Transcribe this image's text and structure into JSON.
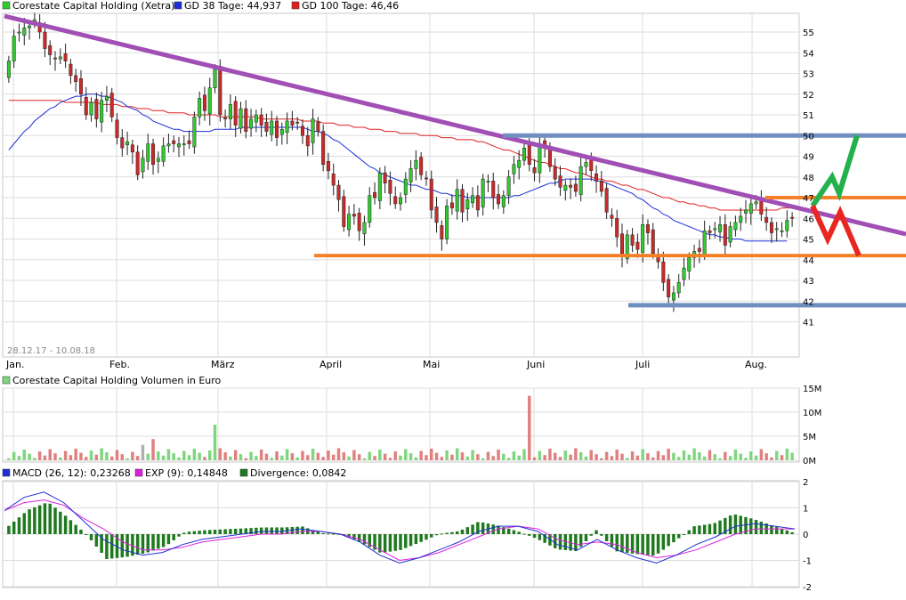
{
  "colors": {
    "price_up": "#2ecc2e",
    "price_down": "#cc2a2a",
    "gd38": "#1f2fd4",
    "gd100": "#e02020",
    "trendline": "#a14fb5",
    "support_orange": "#f4802a",
    "channel_blue": "#6f8fc0",
    "arrow_up": "#22b14c",
    "arrow_down": "#e8261f",
    "volume_up": "#7fd67f",
    "volume_down": "#e08080",
    "macd": "#1f2fd4",
    "exp": "#e020e0",
    "divergence": "#1f7a1f",
    "grid": "#dddddd"
  },
  "icons": {
    "legend_price": "green-square-icon",
    "legend_gd38": "blue-square-icon",
    "legend_gd100": "red-square-icon",
    "legend_volume": "green-square-icon",
    "legend_macd": "blue-square-icon",
    "legend_exp": "magenta-square-icon",
    "legend_divergence": "dark-green-square-icon"
  },
  "chart_data": [
    {
      "type": "candlestick",
      "legend": {
        "price": "Corestate Capital Holding (Xetra)",
        "gd38": "GD 38 Tage: 44,937",
        "gd100": "GD 100 Tage: 46,46"
      },
      "date_range": "28.12.17 - 10.08.18",
      "x_labels": [
        "Jan.",
        "Feb.",
        "März",
        "April",
        "Mai",
        "Juni",
        "Juli",
        "Aug."
      ],
      "y_ticks": [
        "55",
        "54",
        "53",
        "52",
        "51",
        "50",
        "49",
        "48",
        "47",
        "46",
        "45",
        "44",
        "43",
        "42",
        "41"
      ],
      "ylim": [
        40.5,
        55.9
      ],
      "close": [
        53.6,
        54.8,
        55.0,
        55.2,
        55.3,
        55.6,
        55.0,
        54.2,
        53.9,
        53.7,
        53.8,
        53.6,
        52.9,
        52.6,
        52.0,
        51.0,
        51.6,
        50.8,
        51.7,
        51.9,
        50.9,
        49.9,
        49.4,
        49.7,
        49.2,
        48.1,
        48.9,
        49.6,
        48.6,
        48.9,
        49.5,
        49.6,
        49.6,
        49.6,
        49.6,
        49.6,
        50.9,
        51.8,
        51.2,
        52.3,
        53.2,
        51.0,
        50.8,
        51.5,
        50.5,
        51.3,
        50.2,
        50.8,
        51.0,
        50.5,
        50.2,
        50.7,
        49.9,
        50.3,
        50.7,
        50.5,
        50.6,
        50.0,
        49.5,
        50.8,
        50.2,
        48.6,
        48.3,
        47.6,
        46.9,
        45.6,
        46.2,
        46.1,
        45.4,
        45.8,
        47.1,
        47.0,
        48.2,
        47.7,
        47.2,
        46.7,
        47.0,
        47.9,
        48.4,
        48.8,
        48.1,
        47.9,
        46.4,
        45.8,
        45.0,
        46.6,
        46.5,
        47.4,
        46.3,
        46.9,
        47.1,
        46.4,
        47.9,
        47.8,
        47.0,
        46.7,
        47.1,
        48.0,
        48.6,
        48.8,
        49.4,
        48.6,
        48.2,
        49.6,
        49.5,
        48.5,
        47.9,
        47.5,
        47.6,
        47.5,
        47.3,
        48.5,
        48.7,
        48.3,
        47.8,
        47.3,
        46.3,
        46.0,
        45.1,
        44.2,
        45.2,
        44.7,
        44.5,
        45.7,
        45.3,
        44.3,
        43.9,
        42.9,
        42.2,
        42.4,
        42.9,
        43.6,
        44.1,
        44.4,
        44.4,
        45.4,
        45.3,
        45.5,
        45.7,
        44.7,
        45.6,
        45.8,
        46.1,
        46.4,
        46.7,
        46.8,
        46.2,
        45.8,
        45.3,
        45.5,
        45.4,
        45.9,
        46.0
      ],
      "gd38": [
        49.3,
        49.6,
        49.9,
        50.2,
        50.4,
        50.7,
        50.9,
        51.1,
        51.3,
        51.4,
        51.6,
        51.7,
        51.8,
        51.9,
        51.9,
        52.0,
        52.0,
        52.0,
        51.9,
        51.9,
        51.8,
        51.7,
        51.6,
        51.4,
        51.3,
        51.2,
        51.0,
        50.9,
        50.7,
        50.6,
        50.5,
        50.4,
        50.3,
        50.3,
        50.2,
        50.2,
        50.2,
        50.2,
        50.2,
        50.2,
        50.3,
        50.3,
        50.3,
        50.3,
        50.3,
        50.4,
        50.4,
        50.4,
        50.4,
        50.4,
        50.4,
        50.4,
        50.4,
        50.4,
        50.4,
        50.4,
        50.4,
        50.4,
        50.3,
        50.2,
        50.2,
        50.1,
        50.0,
        49.8,
        49.7,
        49.5,
        49.3,
        49.1,
        48.9,
        48.7,
        48.5,
        48.4,
        48.2,
        48.1,
        48.0,
        47.9,
        47.8,
        47.7,
        47.6,
        47.6,
        47.5,
        47.4,
        47.4,
        47.3,
        47.2,
        47.2,
        47.1,
        47.1,
        47.1,
        47.0,
        47.0,
        47.0,
        47.0,
        47.0,
        47.0,
        47.0,
        47.0,
        47.0,
        47.1,
        47.1,
        47.2,
        47.3,
        47.4,
        47.5,
        47.6,
        47.7,
        47.7,
        47.8,
        47.9,
        47.9,
        47.9,
        47.9,
        47.9,
        47.9,
        47.8,
        47.8,
        47.7,
        47.6,
        47.5,
        47.4,
        47.3,
        47.2,
        47.0,
        46.9,
        46.7,
        46.5,
        46.4,
        46.2,
        46.1,
        45.9,
        45.8,
        45.7,
        45.6,
        45.5,
        45.4,
        45.3,
        45.2,
        45.2,
        45.1,
        45.1,
        45.0,
        45.0,
        45.0,
        44.9,
        44.9,
        44.9,
        44.9,
        44.9,
        44.9,
        44.9,
        44.9,
        44.9
      ],
      "gd100": [
        51.7,
        51.7,
        51.7,
        51.7,
        51.7,
        51.7,
        51.7,
        51.7,
        51.7,
        51.7,
        51.7,
        51.6,
        51.6,
        51.6,
        51.6,
        51.6,
        51.6,
        51.6,
        51.5,
        51.5,
        51.5,
        51.5,
        51.4,
        51.4,
        51.4,
        51.3,
        51.3,
        51.3,
        51.2,
        51.2,
        51.2,
        51.1,
        51.1,
        51.1,
        51.1,
        51.0,
        51.0,
        51.0,
        51.0,
        51.0,
        51.0,
        50.9,
        50.9,
        50.9,
        50.9,
        50.9,
        50.9,
        50.9,
        50.9,
        50.8,
        50.8,
        50.8,
        50.8,
        50.8,
        50.8,
        50.8,
        50.8,
        50.7,
        50.7,
        50.7,
        50.7,
        50.6,
        50.6,
        50.6,
        50.5,
        50.5,
        50.5,
        50.4,
        50.4,
        50.4,
        50.3,
        50.3,
        50.3,
        50.2,
        50.2,
        50.2,
        50.1,
        50.1,
        50.1,
        50.1,
        50.0,
        50.0,
        50.0,
        50.0,
        49.9,
        49.9,
        49.9,
        49.8,
        49.8,
        49.8,
        49.8,
        49.7,
        49.7,
        49.6,
        49.5,
        49.4,
        49.3,
        49.3,
        49.2,
        49.1,
        49.0,
        48.9,
        48.8,
        48.7,
        48.7,
        48.6,
        48.5,
        48.4,
        48.4,
        48.3,
        48.2,
        48.2,
        48.1,
        48.0,
        47.9,
        47.9,
        47.8,
        47.8,
        47.7,
        47.6,
        47.6,
        47.5,
        47.4,
        47.4,
        47.3,
        47.2,
        47.1,
        47.0,
        47.0,
        46.9,
        46.8,
        46.8,
        46.7,
        46.7,
        46.6,
        46.6,
        46.5,
        46.5,
        46.4,
        46.4,
        46.4,
        46.4,
        46.4,
        46.4,
        46.4,
        46.4,
        46.4,
        46.4,
        46.4,
        46.4,
        46.5,
        46.5,
        46.5,
        46.5
      ],
      "annotations": {
        "trendline": {
          "from": [
            "Jan.",
            55.6
          ],
          "to": [
            "Aug.",
            45.5
          ]
        },
        "support": {
          "level": 44.2
        },
        "resistance_orange": {
          "level": 47.0
        },
        "channel_top": {
          "level": 50.0
        },
        "channel_bottom": {
          "level": 41.8
        },
        "scenario_up": [
          46.6,
          48.0,
          47.2,
          50.0
        ],
        "scenario_down": [
          46.6,
          45.0,
          46.3,
          44.2
        ]
      }
    },
    {
      "type": "bar",
      "legend": "Corestate Capital Holding Volumen in Euro",
      "y_ticks": [
        "15M",
        "10M",
        "5M",
        "0M"
      ],
      "ylim": [
        0,
        15
      ],
      "spike_values_M": {
        "gray_bar": 3.2,
        "feb_spike": 4.4,
        "march_spike": 7.4,
        "june_spike": 13.4
      },
      "typical_volume_M": [
        0.4,
        2.6
      ]
    },
    {
      "type": "line",
      "legend": {
        "macd": "MACD (26, 12): 0,23268",
        "exp": "EXP (9): 0,14848",
        "divergence": "Divergence: 0,0842"
      },
      "y_ticks": [
        "2",
        "1",
        "0",
        "-1",
        "-2"
      ],
      "ylim": [
        -2,
        2
      ],
      "macd_path": [
        0.9,
        1.4,
        1.6,
        1.2,
        0.5,
        -0.2,
        -0.6,
        -0.8,
        -0.7,
        -0.4,
        -0.2,
        -0.1,
        0.0,
        0.1,
        0.1,
        0.2,
        0.1,
        0.0,
        -0.3,
        -0.8,
        -1.1,
        -0.9,
        -0.6,
        -0.3,
        0.1,
        0.3,
        0.3,
        0.1,
        -0.4,
        -0.6,
        -0.2,
        -0.6,
        -0.9,
        -1.1,
        -0.8,
        -0.4,
        -0.1,
        0.3,
        0.4,
        0.3,
        0.2
      ],
      "exp_path": [
        0.9,
        1.2,
        1.3,
        1.1,
        0.6,
        0.2,
        -0.3,
        -0.6,
        -0.6,
        -0.5,
        -0.3,
        -0.2,
        -0.1,
        0.0,
        0.0,
        0.1,
        0.1,
        0.0,
        -0.2,
        -0.6,
        -1.0,
        -0.9,
        -0.7,
        -0.4,
        -0.1,
        0.2,
        0.3,
        0.2,
        -0.2,
        -0.4,
        -0.3,
        -0.4,
        -0.7,
        -0.9,
        -0.8,
        -0.6,
        -0.3,
        0.0,
        0.2,
        0.2,
        0.2
      ]
    }
  ]
}
